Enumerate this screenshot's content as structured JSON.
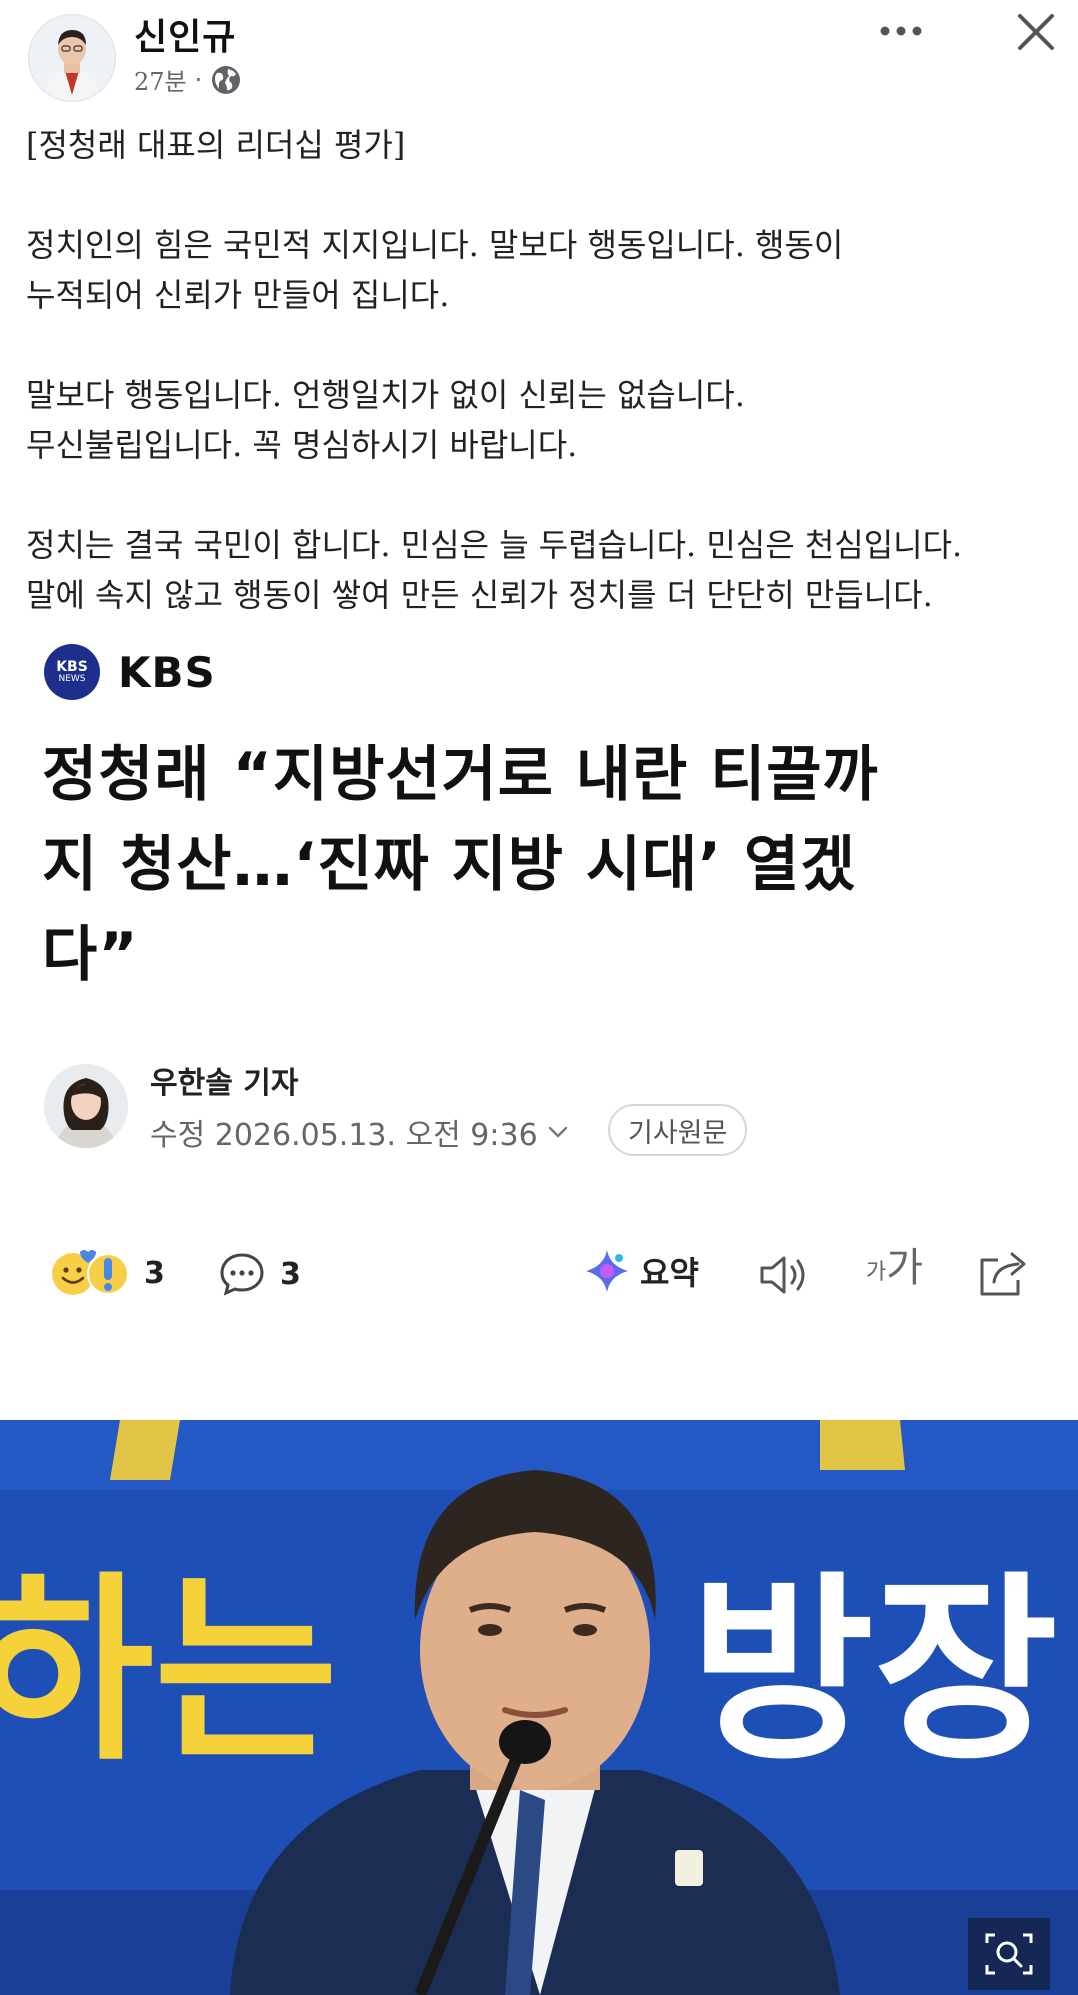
{
  "post": {
    "author": "신인규",
    "time": "27분",
    "meta_dot": "·",
    "visibility_icon": "globe-icon",
    "lines": [
      "[정청래 대표의 리더십 평가]",
      "",
      "정치인의 힘은 국민적 지지입니다. 말보다 행동입니다. 행동이",
      "누적되어 신뢰가 만들어 집니다.",
      "",
      "말보다 행동입니다. 언행일치가 없이 신뢰는 없습니다.",
      "무신불립입니다. 꼭 명심하시기 바랍니다.",
      "",
      "정치는 결국 국민이 합니다. 민심은 늘 두렵습니다. 민심은 천심입니다.",
      "말에 속지 않고 행동이 쌓여 만든 신뢰가 정치를 더 단단히 만듭니다."
    ]
  },
  "article": {
    "source_logo_line1": "KBS",
    "source_logo_line2": "NEWS",
    "source_name": "KBS",
    "headline_lines": [
      "정청래 “지방선거로 내란 티끌까",
      "지 청산…‘진짜 지방 시대’ 열겠",
      "다”"
    ],
    "reporter": "우한솔 기자",
    "edit_date": "수정 2026.05.13. 오전 9:36",
    "original_button": "기사원문"
  },
  "actions": {
    "reaction_count": "3",
    "comment_count": "3",
    "summary_label": "요약",
    "font_small": "가",
    "font_big": "가"
  },
  "photo": {
    "banner_text_left": "하는",
    "banner_text_right": "방장"
  },
  "colors": {
    "banner_blue": "#1e4fb7",
    "banner_yellow": "#f6d23a",
    "kbs_navy": "#1d2f8a"
  }
}
